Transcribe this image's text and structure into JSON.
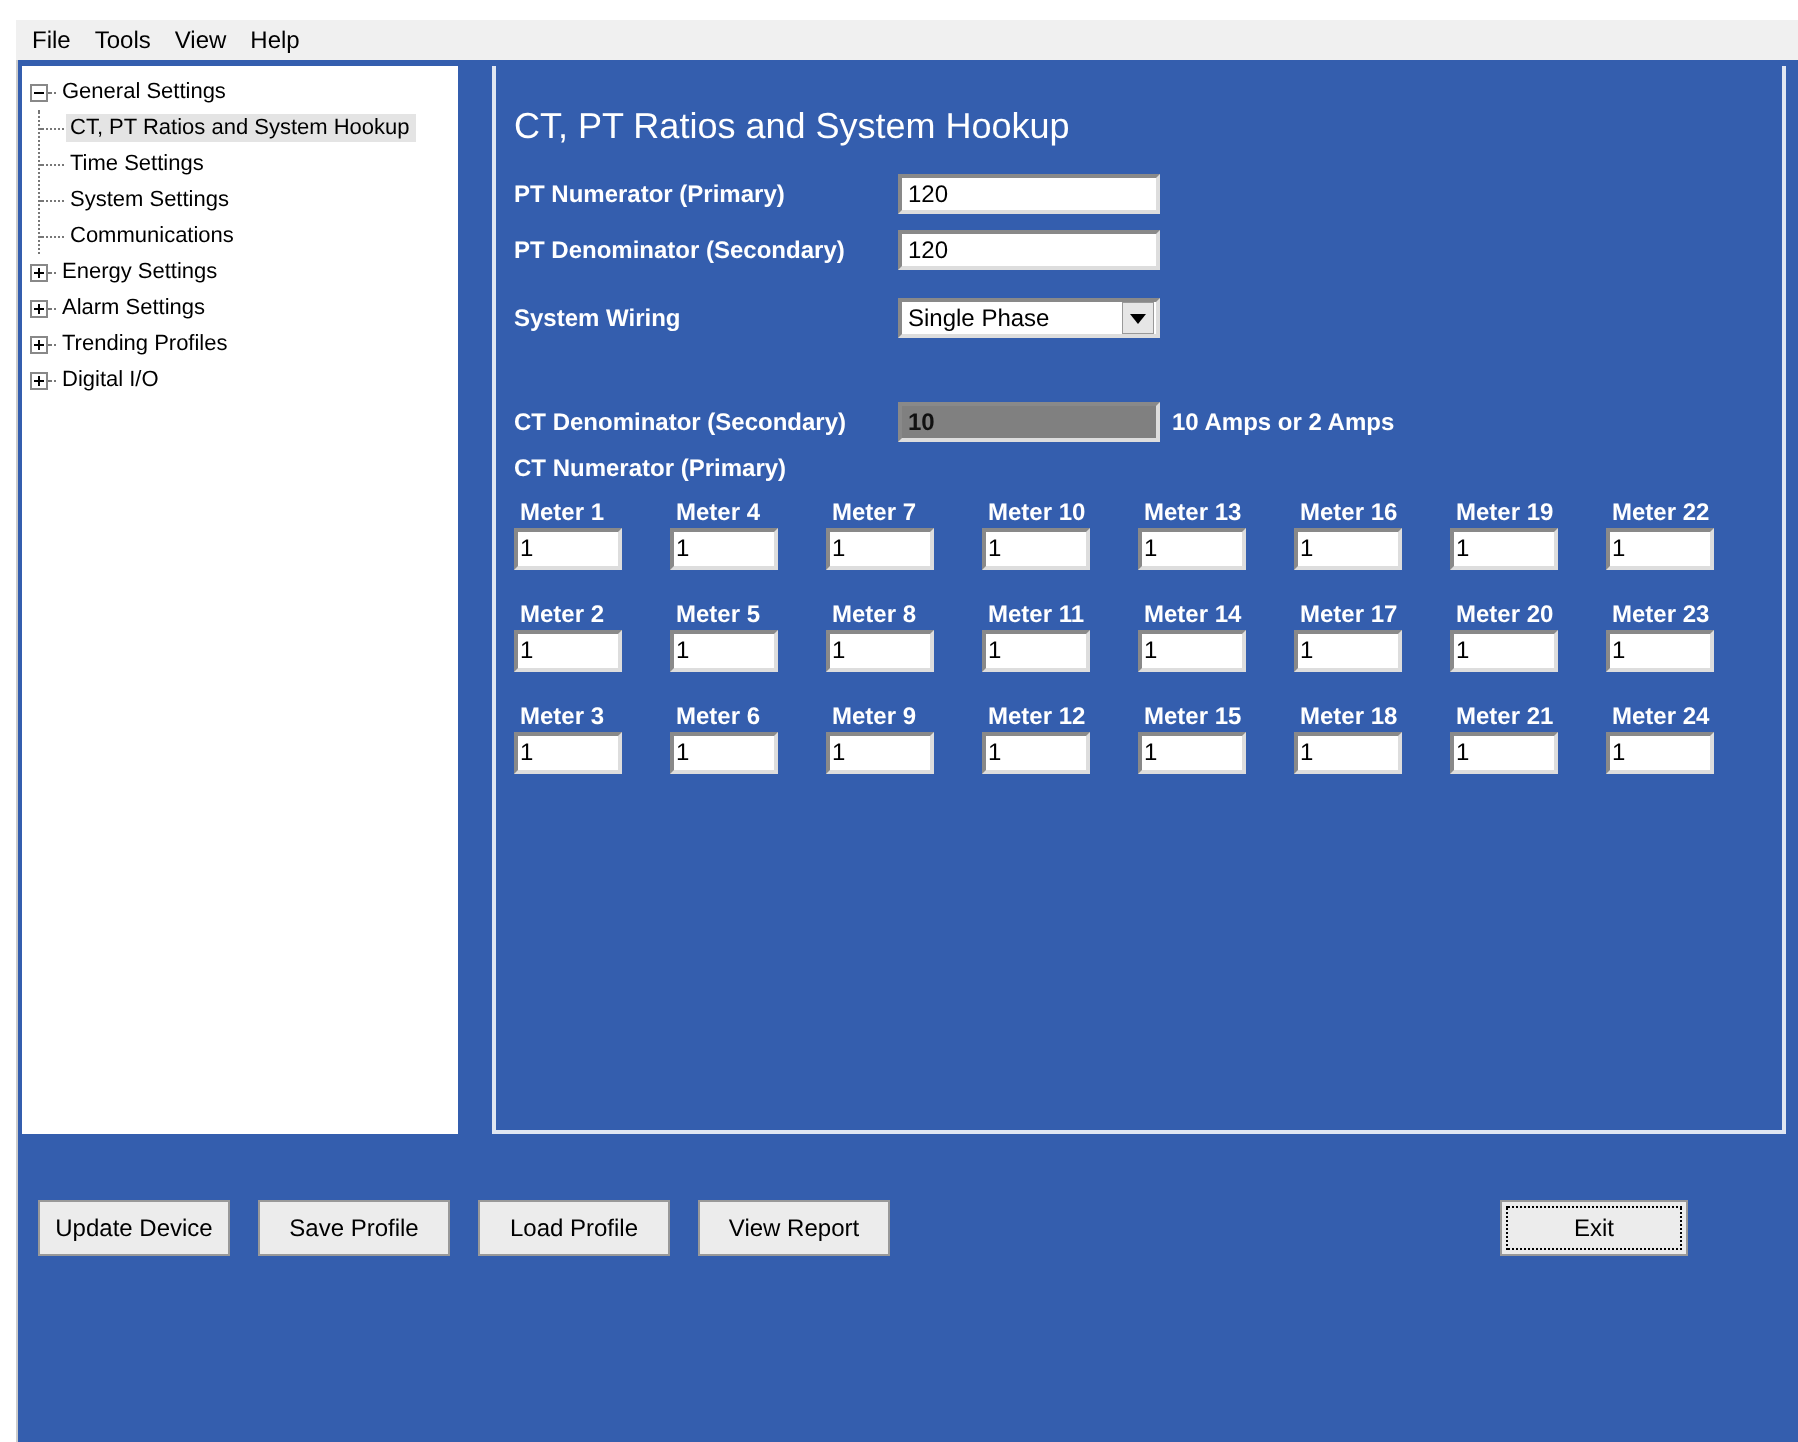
{
  "menu": [
    "File",
    "Tools",
    "View",
    "Help"
  ],
  "tree": [
    {
      "label": "General Settings",
      "expanded": true,
      "children": [
        {
          "label": "CT, PT Ratios and System Hookup",
          "selected": true
        },
        {
          "label": "Time Settings",
          "selected": false
        },
        {
          "label": "System Settings",
          "selected": false
        },
        {
          "label": "Communications",
          "selected": false
        }
      ]
    },
    {
      "label": "Energy Settings",
      "expanded": false
    },
    {
      "label": "Alarm Settings",
      "expanded": false
    },
    {
      "label": "Trending Profiles",
      "expanded": false
    },
    {
      "label": "Digital I/O",
      "expanded": false
    }
  ],
  "panel": {
    "title": "CT, PT Ratios and System Hookup",
    "fields": [
      {
        "kind": "text",
        "label": "PT Numerator (Primary)",
        "value": "120"
      },
      {
        "kind": "text",
        "label": "PT Denominator (Secondary)",
        "value": "120"
      },
      {
        "kind": "select",
        "label": "System Wiring",
        "value": "Single Phase"
      },
      {
        "kind": "text",
        "label": "CT Denominator (Secondary)",
        "value": "10",
        "disabled": true,
        "note": "10 Amps or 2 Amps"
      }
    ],
    "ct_numerator_label": "CT Numerator (Primary)",
    "meters": [
      {
        "label": "Meter 1",
        "value": "1"
      },
      {
        "label": "Meter 2",
        "value": "1"
      },
      {
        "label": "Meter 3",
        "value": "1"
      },
      {
        "label": "Meter 4",
        "value": "1"
      },
      {
        "label": "Meter 5",
        "value": "1"
      },
      {
        "label": "Meter 6",
        "value": "1"
      },
      {
        "label": "Meter 7",
        "value": "1"
      },
      {
        "label": "Meter 8",
        "value": "1"
      },
      {
        "label": "Meter 9",
        "value": "1"
      },
      {
        "label": "Meter 10",
        "value": "1"
      },
      {
        "label": "Meter 11",
        "value": "1"
      },
      {
        "label": "Meter 12",
        "value": "1"
      },
      {
        "label": "Meter 13",
        "value": "1"
      },
      {
        "label": "Meter 14",
        "value": "1"
      },
      {
        "label": "Meter 15",
        "value": "1"
      },
      {
        "label": "Meter 16",
        "value": "1"
      },
      {
        "label": "Meter 17",
        "value": "1"
      },
      {
        "label": "Meter 18",
        "value": "1"
      },
      {
        "label": "Meter 19",
        "value": "1"
      },
      {
        "label": "Meter 20",
        "value": "1"
      },
      {
        "label": "Meter 21",
        "value": "1"
      },
      {
        "label": "Meter 22",
        "value": "1"
      },
      {
        "label": "Meter 23",
        "value": "1"
      },
      {
        "label": "Meter 24",
        "value": "1"
      }
    ]
  },
  "buttons": [
    {
      "label": "Update Device",
      "focused": false
    },
    {
      "label": "Save Profile",
      "focused": false
    },
    {
      "label": "Load Profile",
      "focused": false
    },
    {
      "label": "View Report",
      "focused": false
    }
  ],
  "exit_button": {
    "label": "Exit",
    "focused": true
  }
}
